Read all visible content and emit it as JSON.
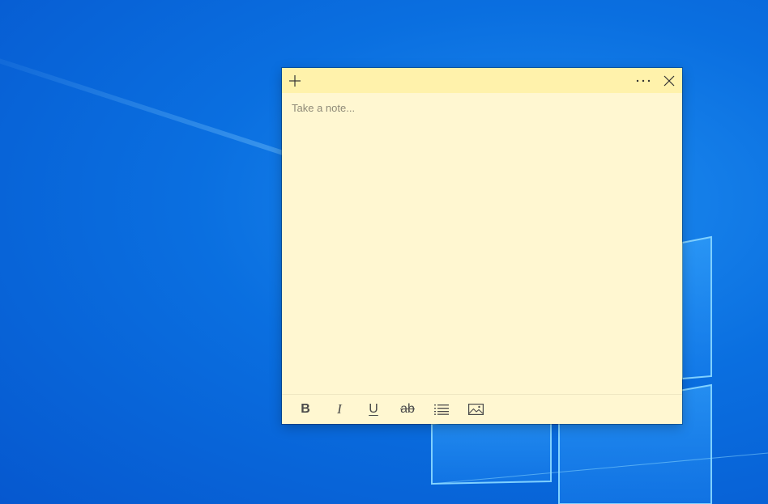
{
  "note": {
    "placeholder": "Take a note...",
    "content": "",
    "background_color": "#fff7d1",
    "titlebar_color": "#fff2ab",
    "titlebar": {
      "new_icon": "plus-icon",
      "menu_icon": "more-icon",
      "close_icon": "close-icon"
    },
    "toolbar": {
      "bold_label": "B",
      "italic_label": "I",
      "underline_label": "U",
      "strikethrough_label": "ab",
      "list_icon": "bullet-list-icon",
      "image_icon": "image-icon"
    }
  },
  "desktop": {
    "background_color": "#0a6fe0"
  }
}
